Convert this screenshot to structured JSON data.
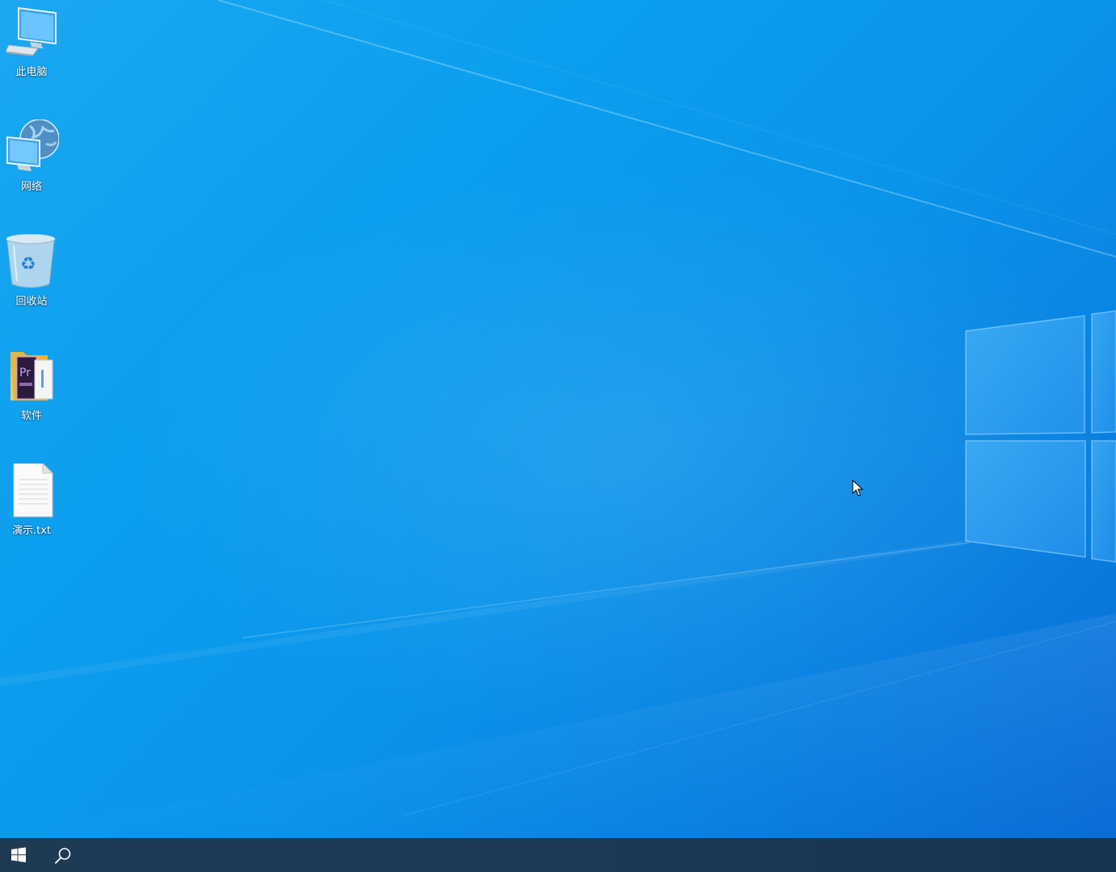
{
  "desktop": {
    "icons": [
      {
        "label": "此电脑",
        "icon": "this-pc-icon"
      },
      {
        "label": "网络",
        "icon": "network-icon"
      },
      {
        "label": "回收站",
        "icon": "recycle-bin-icon"
      },
      {
        "label": "软件",
        "icon": "folder-icon"
      },
      {
        "label": "演示.txt",
        "icon": "text-file-icon"
      }
    ]
  },
  "taskbar": {
    "start_icon": "windows-logo-icon",
    "search_icon": "search-icon",
    "color": "#1c3957"
  },
  "wallpaper": {
    "theme": "Windows 10 default blue",
    "accent": "#0a94ea"
  }
}
